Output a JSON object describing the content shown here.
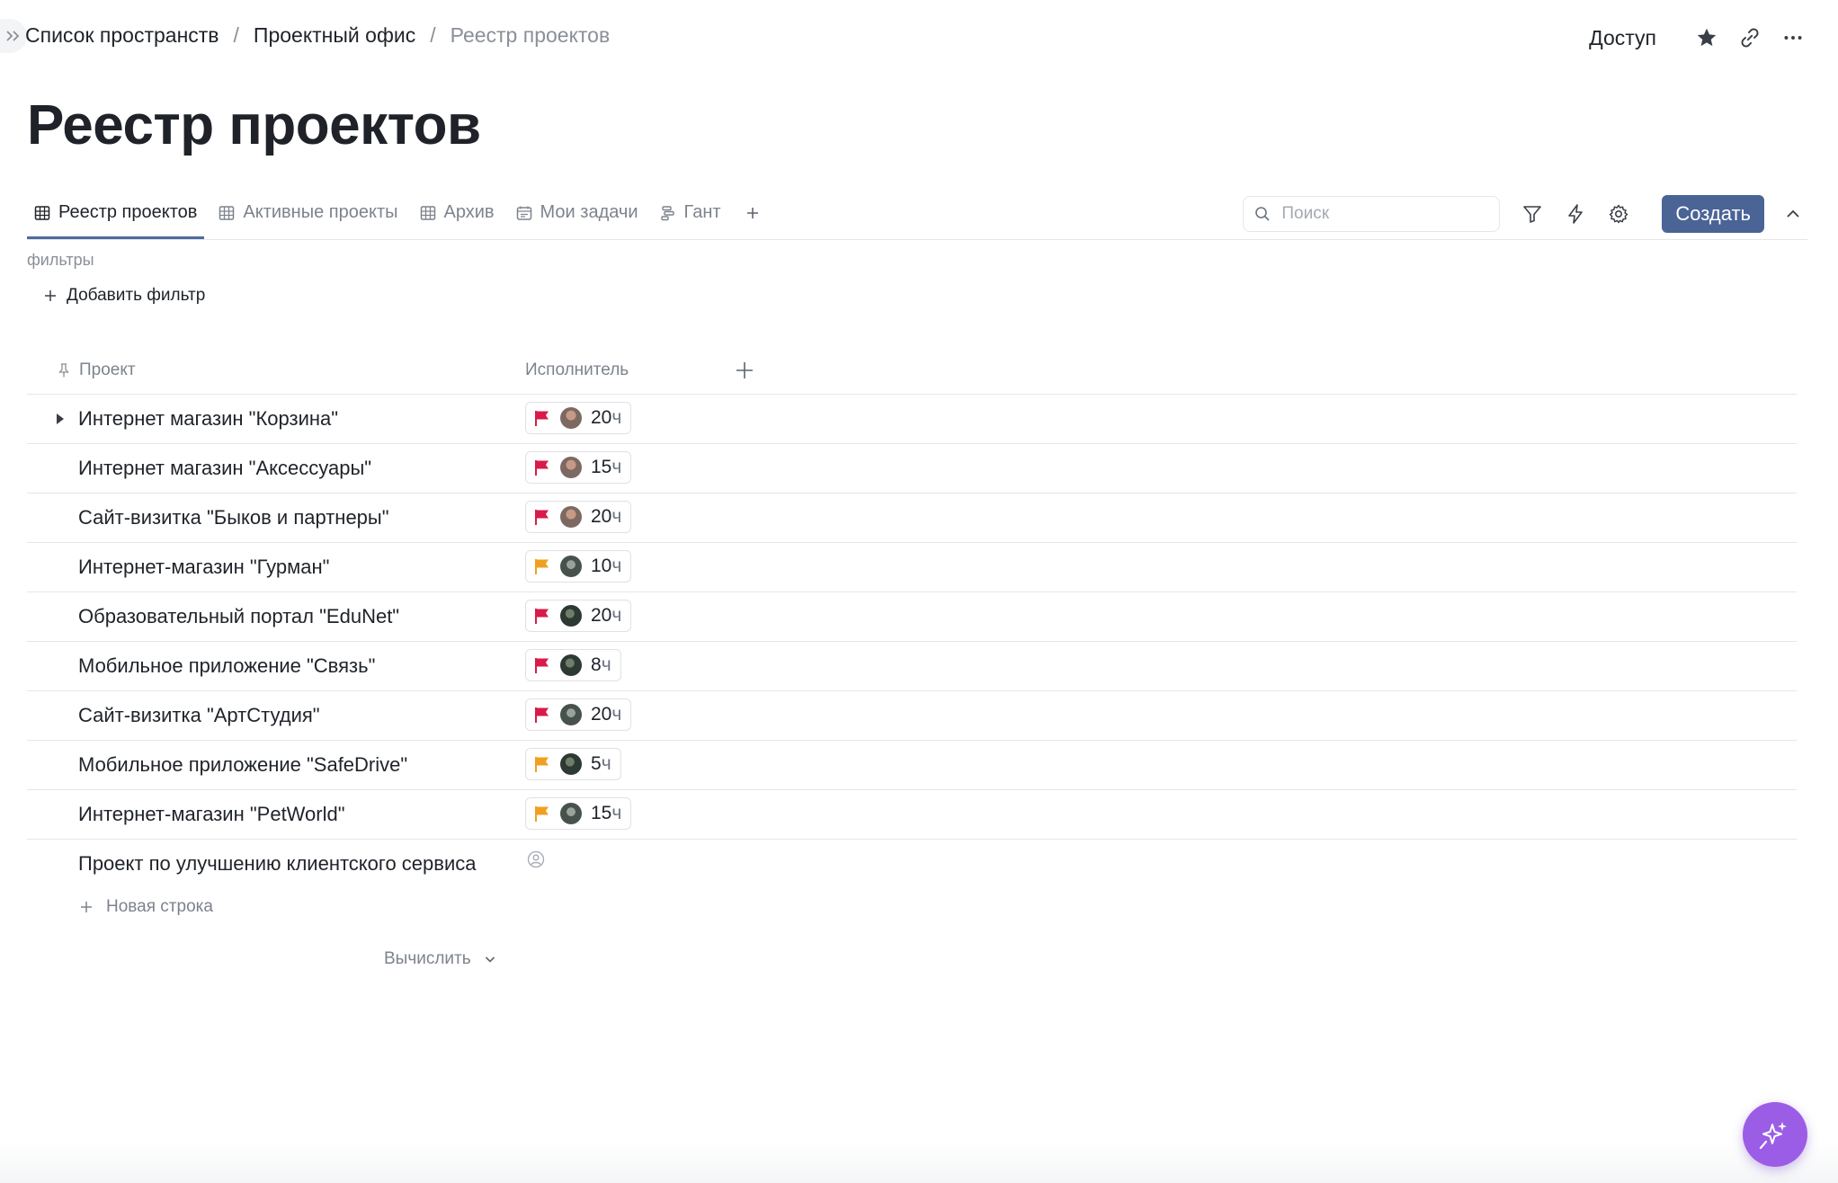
{
  "breadcrumb": {
    "items": [
      "Список пространств",
      "Проектный офис",
      "Реестр проектов"
    ],
    "separator": "/"
  },
  "header": {
    "access_label": "Доступ"
  },
  "page": {
    "title": "Реестр проектов"
  },
  "tabs": [
    {
      "label": "Реестр проектов",
      "icon": "table-icon",
      "active": true
    },
    {
      "label": "Активные проекты",
      "icon": "table-icon",
      "active": false
    },
    {
      "label": "Архив",
      "icon": "table-icon",
      "active": false
    },
    {
      "label": "Мои задачи",
      "icon": "calendar-icon",
      "active": false
    },
    {
      "label": "Гант",
      "icon": "gantt-icon",
      "active": false
    }
  ],
  "toolbar": {
    "search_placeholder": "Поиск",
    "create_label": "Создать"
  },
  "filters": {
    "label": "фильтры",
    "add_label": "Добавить фильтр"
  },
  "table": {
    "columns": [
      "Проект",
      "Исполнитель"
    ],
    "rows": [
      {
        "name": "Интернет магазин \"Корзина\"",
        "flag": "red",
        "avatar": "light",
        "hours": "20",
        "expandable": true
      },
      {
        "name": "Интернет магазин \"Аксессуары\"",
        "flag": "red",
        "avatar": "light",
        "hours": "15",
        "expandable": false
      },
      {
        "name": "Сайт-визитка \"Быков и партнеры\"",
        "flag": "red",
        "avatar": "light",
        "hours": "20",
        "expandable": false
      },
      {
        "name": "Интернет-магазин \"Гурман\"",
        "flag": "orange",
        "avatar": "mixed",
        "hours": "10",
        "expandable": false
      },
      {
        "name": "Образовательный портал \"EduNet\"",
        "flag": "red",
        "avatar": "dark",
        "hours": "20",
        "expandable": false
      },
      {
        "name": "Мобильное приложение \"Связь\"",
        "flag": "red",
        "avatar": "dark",
        "hours": "8",
        "expandable": false
      },
      {
        "name": "Сайт-визитка \"АртСтудия\"",
        "flag": "red",
        "avatar": "mixed",
        "hours": "20",
        "expandable": false
      },
      {
        "name": "Мобильное приложение \"SafeDrive\"",
        "flag": "orange",
        "avatar": "dark",
        "hours": "5",
        "expandable": false
      },
      {
        "name": "Интернет-магазин \"PetWorld\"",
        "flag": "orange",
        "avatar": "mixed",
        "hours": "15",
        "expandable": false
      },
      {
        "name": "Проект по улучшению клиентского сервиса",
        "flag": null,
        "avatar": null,
        "hours": null,
        "expandable": false
      }
    ],
    "hours_unit": "ч",
    "new_row_label": "Новая строка",
    "calculate_label": "Вычислить"
  },
  "colors": {
    "accent": "#4a6496",
    "flag_red": "#d81b4a",
    "flag_orange": "#f0a020",
    "fab": "#9b5de5"
  }
}
